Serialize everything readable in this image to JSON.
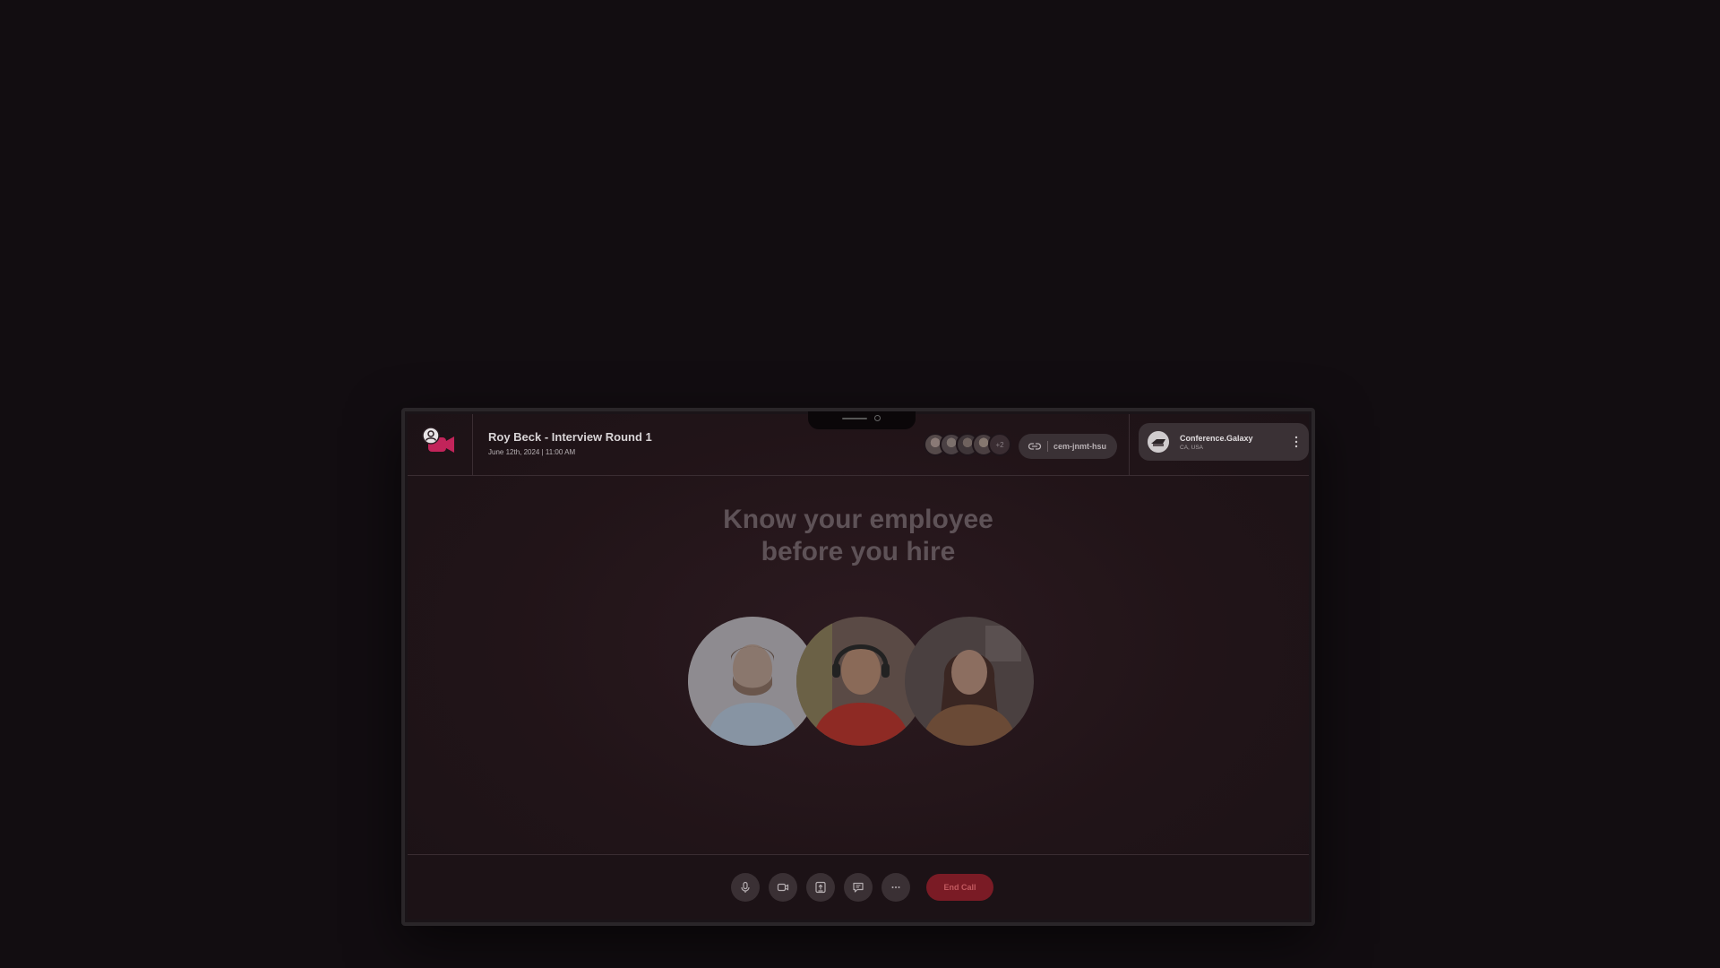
{
  "meeting": {
    "title": "Roy Beck - Interview Round 1",
    "datetime": "June 12th, 2024 | 11:00 AM"
  },
  "participants": {
    "more_count": "+2"
  },
  "meeting_link": {
    "icon": "link-icon",
    "code": "cem-jnmt-hsu"
  },
  "company": {
    "name": "Conference.Galaxy",
    "location": "CA, USA"
  },
  "main": {
    "headline_line1": "Know your employee",
    "headline_line2": "before you hire"
  },
  "controls": {
    "items": [
      "mic-icon",
      "video-icon",
      "share-screen-icon",
      "chat-icon",
      "more-icon"
    ],
    "end_call_label": "End Call"
  },
  "colors": {
    "accent": "#e0306a",
    "end_call": "#7a1b25",
    "background": "#120d11"
  }
}
